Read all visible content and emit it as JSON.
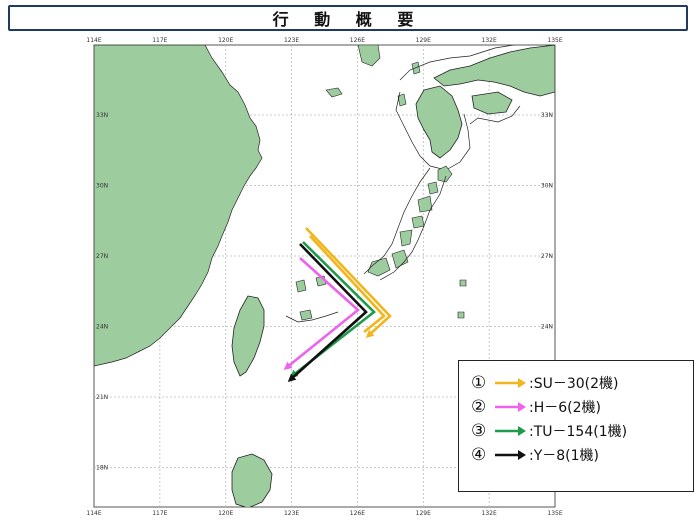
{
  "title": "行 動 概 要",
  "map": {
    "lon_labels": [
      "114E",
      "117E",
      "120E",
      "123E",
      "126E",
      "129E",
      "132E",
      "135E"
    ],
    "lat_labels": [
      "33N",
      "30N",
      "27N",
      "24N",
      "21N",
      "18N"
    ],
    "colors": {
      "land": "#9dcc9f",
      "sea": "#ffffff",
      "grid": "#b9b9b9",
      "coast": "#222222"
    }
  },
  "routes": [
    {
      "num": "①",
      "label": ":SU－30(2機)",
      "color": "#f2b51c"
    },
    {
      "num": "②",
      "label": ":H－6(2機)",
      "color": "#ee63ee"
    },
    {
      "num": "③",
      "label": ":TU－154(1機)",
      "color": "#1f9a4a"
    },
    {
      "num": "④",
      "label": ":Y－8(1機)",
      "color": "#111111"
    }
  ]
}
